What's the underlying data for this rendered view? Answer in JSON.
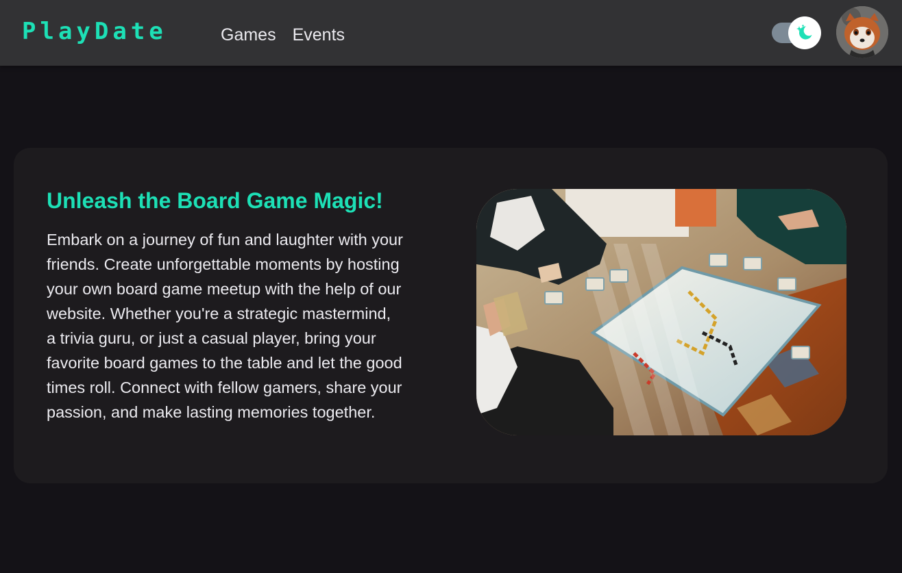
{
  "header": {
    "logo": "PlayDate",
    "nav": [
      {
        "label": "Games"
      },
      {
        "label": "Events"
      }
    ],
    "theme_toggle": {
      "state": "dark",
      "icon": "moon-stars-icon"
    },
    "avatar": {
      "icon": "red-panda-avatar"
    }
  },
  "hero": {
    "title": "Unleash the Board Game Magic!",
    "body": "Embark on a journey of fun and laughter with your friends. Create unforgettable moments by hosting your own board game meetup with the help of our website. Whether you're a strategic mastermind, a trivia guru, or just a casual player, bring your favorite board games to the table and let the good times roll. Connect with fellow gamers, share your passion, and make lasting memories together.",
    "image": {
      "icon": "board-game-photo"
    }
  },
  "colors": {
    "accent": "#1de0b6",
    "header_bg": "#323234",
    "page_bg": "#141217",
    "card_bg": "#1d1b1e",
    "text": "#ecebf0"
  }
}
